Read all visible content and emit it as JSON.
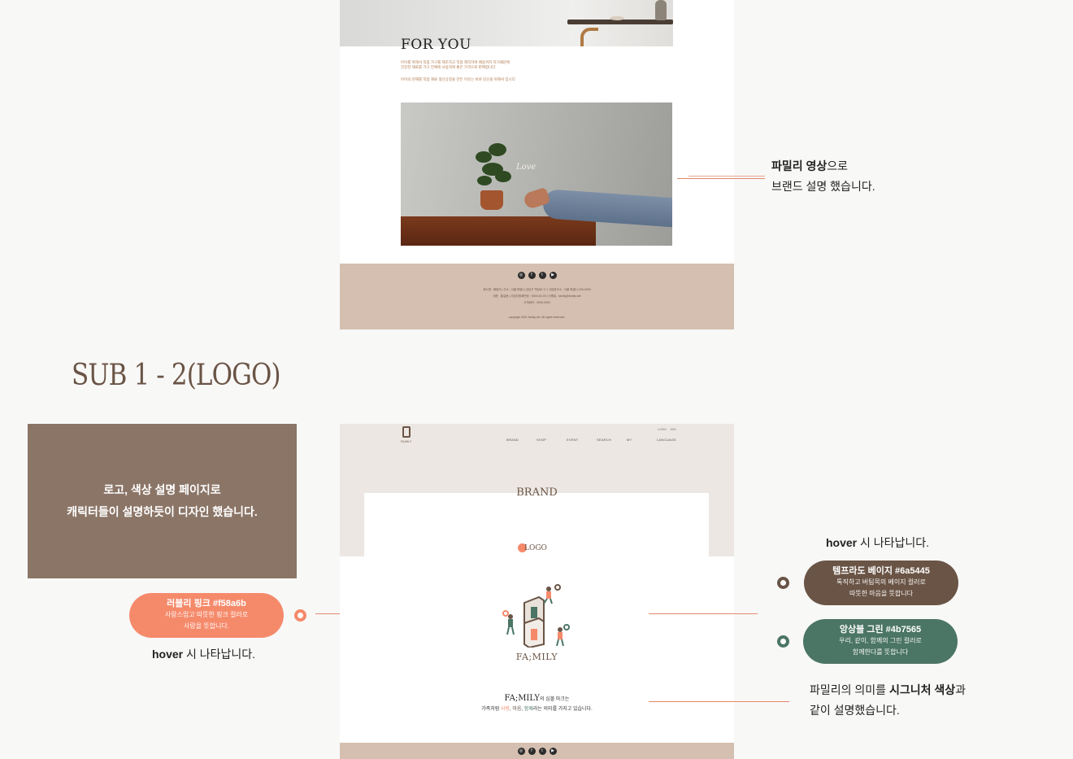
{
  "top_mockup": {
    "heading": "FOR YOU",
    "intro_lines": [
      "아이를 위해서 직접 가구를 제조하고 직접 제작하여 배송까지 하기때문에",
      "건강한 재료를 가구 전체에 사용하여 좋은 가격으로 판매합니다",
      "아이의 현재를 직접 재료 생산공정을 만든 이유는 바로 당신을 위해서 입니다"
    ],
    "video_overlay": "Love",
    "social_icons": [
      "instagram-icon",
      "facebook-icon",
      "twitter-icon",
      "youtube-icon"
    ],
    "social_glyphs": [
      "◎",
      "f",
      "t",
      "▶"
    ],
    "footer_lines": [
      "회사명 : 패밀리  |  주소 : 서울 특별시 강남구 역삼로 17  |  사업장주소 : 서울 특별시 000-0000",
      "대표 : 홍길동  |  사업자등록번호 : 0000-00-00  |  이메일 : family@family.net",
      "고객센터 : 0000-0000",
      "copyright 2021 family.net. All rights reserved."
    ]
  },
  "callouts": {
    "video": {
      "bold": "파밀리 영상",
      "rest1": "으로",
      "line2": "브랜드 설명 했습니다."
    },
    "signature": {
      "pre": "파밀리의 의미를 ",
      "bold": "시그니처 색상",
      "post": "과",
      "line2": "같이 설명했습니다."
    }
  },
  "section_title": "SUB 1 - 2(LOGO)",
  "description": {
    "line1": "로고, 색상 설명 페이지로",
    "line2": "캐릭터들이 설명하듯이 디자인 했습니다."
  },
  "pills": [
    {
      "title": "러블리 핑크 #f58a6b",
      "desc1": "사랑스럽고 따뜻한 핑크 컬러로",
      "desc2": "사랑을 뜻합니다.",
      "color": "#f58a6b"
    },
    {
      "title": "템프라도 베이지 #6a5445",
      "desc1": "톡직하고 버팀목의 베이지 컬러로",
      "desc2": "따뜻한 마음을 뜻합니다",
      "color": "#6a5445"
    },
    {
      "title": "앙상블 그린 #4b7565",
      "desc1": "우리, 같이, 함께의 그린 컬러로",
      "desc2": "함께한다를 뜻합니다",
      "color": "#4b7565"
    }
  ],
  "hover_note": {
    "bold": "hover",
    "rest": " 시 나타납니다."
  },
  "bottom_mockup": {
    "logo_text": "FA;MILY",
    "login": "LOGIN  JOIN",
    "nav": [
      "BRAND",
      "SHOP",
      "EVENT",
      "SEARCH",
      "MY",
      "LANGUAGE"
    ],
    "page_title": "BRAND",
    "logo_tag": "LOGO",
    "family_word": "FA;MILY",
    "meaning_line1_mark": "FA;MILY",
    "meaning_line1_rest": "의 심볼 마크는",
    "meaning_line2": {
      "pre": "가족처럼 ",
      "w1": "사랑",
      "sep1": ", ",
      "w2": "마음",
      "sep2": ", ",
      "w3": "함께",
      "post": "라는 의미를 가지고 있습니다."
    }
  }
}
